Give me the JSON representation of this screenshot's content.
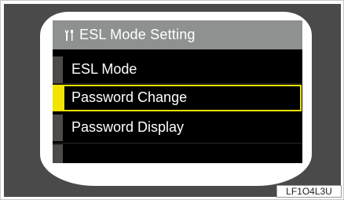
{
  "screen": {
    "header": {
      "title": "ESL Mode Setting",
      "icon": "wrench-screwdriver-icon"
    },
    "menu": {
      "items": [
        {
          "label": "ESL Mode",
          "selected": false
        },
        {
          "label": "Password Change",
          "selected": true
        },
        {
          "label": "Password Display",
          "selected": false
        }
      ]
    }
  },
  "figure_code": "LF1O4L3U",
  "colors": {
    "header_bg": "#8f9191",
    "screen_bg": "#000000",
    "highlight": "#f2e400",
    "bezel": "#4a4a4a"
  }
}
